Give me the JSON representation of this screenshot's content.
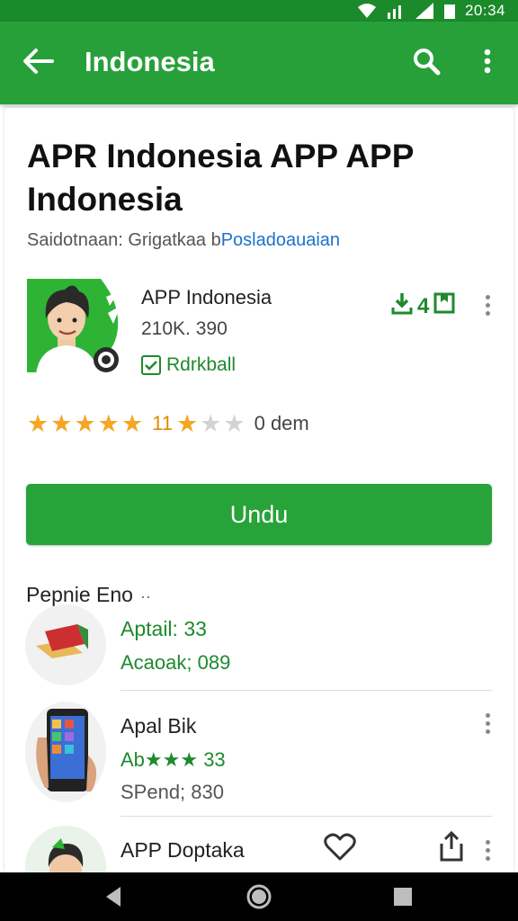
{
  "status_bar": {
    "time": "20:34"
  },
  "app_bar": {
    "title": "Indonesia"
  },
  "app": {
    "title": "APR Indonesia APP APP Indonesia",
    "subtitle_prefix": "Saidotnaan: Grigatkaa b",
    "subtitle_link": "Posladoauaian",
    "name": "APP Indonesia",
    "size": "210K. 390",
    "badge": "Rdrkball",
    "download_count": "4",
    "rating_count": "11",
    "rating_suffix": "0 dem",
    "rating_stars_filled": 6,
    "rating_stars_total": 8
  },
  "install_button": {
    "label": "Undu"
  },
  "section": {
    "title": "Pepnie Eno",
    "more": "··"
  },
  "list": [
    {
      "line1": "Aptail: 33",
      "line2": "Acaoak; 089"
    },
    {
      "line1": "Apal Bik",
      "line2": "Ab★★★ 33",
      "line3": "SPend; 830"
    },
    {
      "line1": "APP Doptaka"
    }
  ],
  "colors": {
    "accent": "#27a03a",
    "link": "#1a73c9",
    "star": "#f5a623",
    "green_text": "#1e8a2d"
  },
  "icons": [
    "back-arrow-icon",
    "search-icon",
    "more-vert-icon",
    "download-icon",
    "bookmark-icon",
    "check-box-icon",
    "star-icon",
    "heart-icon",
    "share-icon",
    "nav-back-icon",
    "nav-home-icon",
    "nav-recent-icon"
  ]
}
